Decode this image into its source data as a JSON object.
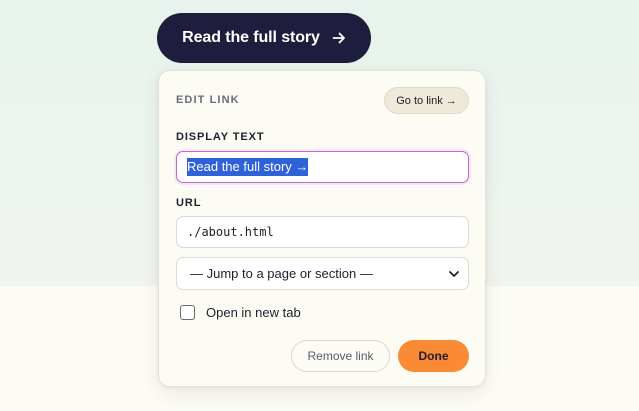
{
  "cta": {
    "label": "Read the full story",
    "icon": "arrow-right-icon"
  },
  "panel": {
    "title": "EDIT LINK",
    "goto_label": "Go to link →",
    "display_text": {
      "label": "DISPLAY TEXT",
      "value": "Read the full story →"
    },
    "url": {
      "label": "URL",
      "value": "./about.html"
    },
    "jump_select": {
      "selected": "— Jump to a page or section —",
      "icon": "chevron-down-icon"
    },
    "new_tab": {
      "label": "Open in new tab",
      "checked": false
    },
    "remove_label": "Remove link",
    "done_label": "Done"
  },
  "colors": {
    "cta_bg": "#1f1d3d",
    "accent": "#fb8a34",
    "focus_ring": "#c266d6",
    "selection": "#2f62d9"
  }
}
